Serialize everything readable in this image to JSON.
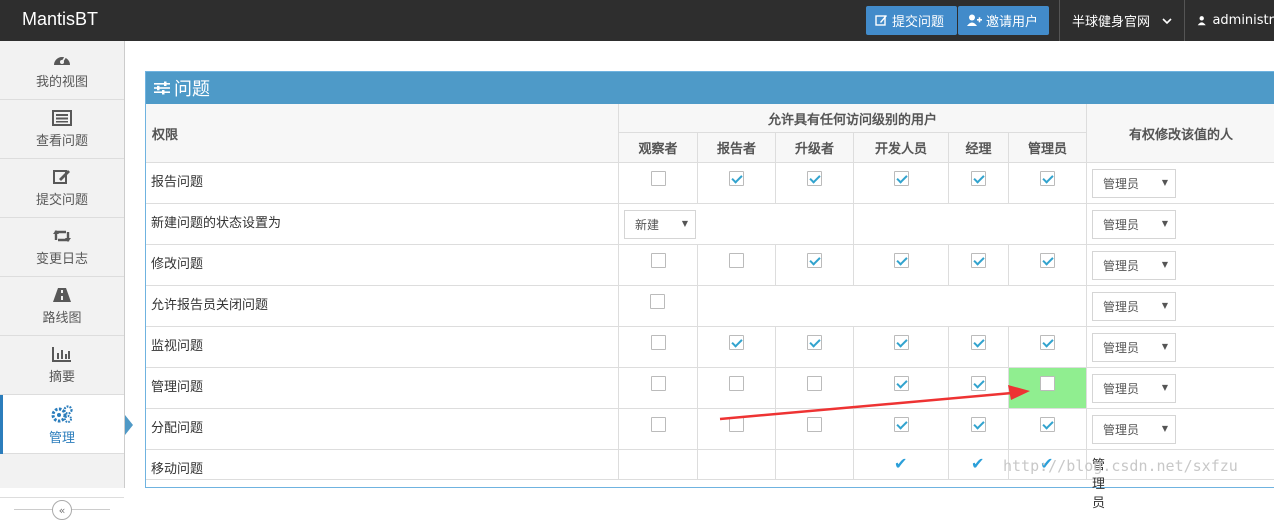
{
  "navbar": {
    "brand": "MantisBT",
    "report_btn": "提交问题",
    "invite_btn": "邀请用户",
    "project": "半球健身官网",
    "user": "administr"
  },
  "sidebar": {
    "items": [
      {
        "label": "我的视图",
        "icon": "tachometer-icon"
      },
      {
        "label": "查看问题",
        "icon": "list-icon"
      },
      {
        "label": "提交问题",
        "icon": "edit-icon"
      },
      {
        "label": "变更日志",
        "icon": "retweet-icon"
      },
      {
        "label": "路线图",
        "icon": "road-icon"
      },
      {
        "label": "摘要",
        "icon": "bar-chart-icon"
      },
      {
        "label": "管理",
        "icon": "gears-icon"
      }
    ],
    "collapse": "«"
  },
  "panel": {
    "title": "问题",
    "col_permission": "权限",
    "col_group": "允许具有任何访问级别的用户",
    "col_modify": "有权修改该值的人",
    "levels": [
      "观察者",
      "报告者",
      "升级者",
      "开发人员",
      "经理",
      "管理员"
    ],
    "rows": [
      {
        "label": "报告问题",
        "checks": [
          false,
          true,
          true,
          true,
          true,
          true
        ],
        "select": "管理员"
      },
      {
        "label": "新建问题的状态设置为",
        "status_select": "新建",
        "select": "管理员"
      },
      {
        "label": "修改问题",
        "checks": [
          false,
          false,
          true,
          true,
          true,
          true
        ],
        "select": "管理员"
      },
      {
        "label": "允许报告员关闭问题",
        "checks": [
          false
        ],
        "select": "管理员"
      },
      {
        "label": "监视问题",
        "checks": [
          false,
          true,
          true,
          true,
          true,
          true
        ],
        "select": "管理员"
      },
      {
        "label": "管理问题",
        "checks": [
          false,
          false,
          false,
          true,
          true,
          false
        ],
        "select": "管理员"
      },
      {
        "label": "分配问题",
        "checks": [
          false,
          false,
          false,
          true,
          true,
          true
        ],
        "select": "管理员"
      },
      {
        "label": "移动问题",
        "ticks": [
          false,
          false,
          false,
          true,
          true,
          true
        ],
        "select_text": "管理员"
      }
    ]
  },
  "colors": {
    "navbar": "#2e2e2e",
    "panel_header": "#4e9ac8",
    "highlight": "#90ee90",
    "arrow": "#ee3333"
  },
  "watermark": "http://blog.csdn.net/sxfzu"
}
